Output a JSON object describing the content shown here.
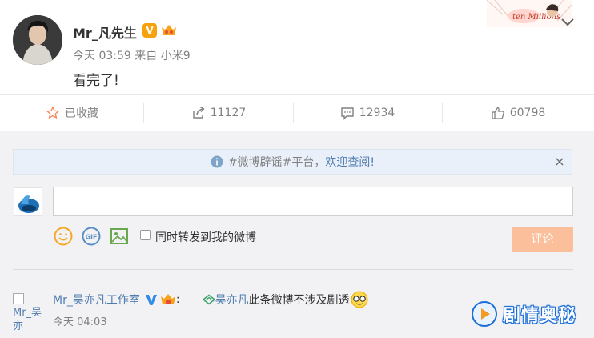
{
  "post": {
    "username": "Mr_凡先生",
    "verified_badge": "V",
    "meta": "今天 03:59 来自 小米9",
    "text": "看完了!",
    "corner_decoration_text": "ten Millions"
  },
  "actions": {
    "favorite_label": "已收藏",
    "repost_count": "11127",
    "comment_count": "12934",
    "like_count": "60798",
    "favorite_icon": "star-outline-icon",
    "repost_icon": "share-arrow-icon",
    "comment_icon": "speech-bubble-icon",
    "like_icon": "thumbs-up-icon"
  },
  "notice": {
    "text_before": "#微博辟谣#平台，",
    "link": "欢迎查阅!",
    "close": "×"
  },
  "composer": {
    "input_value": "",
    "repost_option": "同时转发到我的微博",
    "submit_label": "评论",
    "tools": [
      "emoji-icon",
      "gif-icon",
      "image-icon"
    ]
  },
  "comment": {
    "avatar_alt": "Mr_吴亦",
    "author": "Mr_吴亦凡工作室",
    "colon": ":",
    "mention": "吴亦凡",
    "text": "此条微博不涉及剧透",
    "time": "今天 04:03"
  },
  "watermark": {
    "text": "剧情奥秘"
  },
  "colors": {
    "link_blue": "#507daf",
    "accent_orange": "#ff8140",
    "submit_disabled": "#fbbf9c",
    "notice_bg": "#eaf0f9"
  }
}
